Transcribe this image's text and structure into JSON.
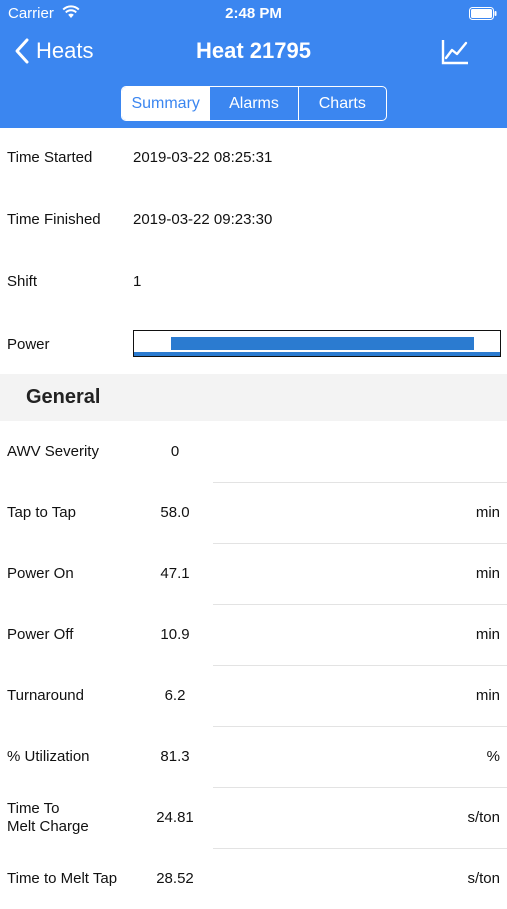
{
  "status": {
    "carrier": "Carrier",
    "time": "2:48 PM"
  },
  "nav": {
    "back_label": "Heats",
    "title": "Heat 21795",
    "chart_icon": "line-chart-icon"
  },
  "tabs": [
    {
      "label": "Summary",
      "active": true
    },
    {
      "label": "Alarms",
      "active": false
    },
    {
      "label": "Charts",
      "active": false
    }
  ],
  "summary": {
    "time_started": {
      "label": "Time Started",
      "value": "2019-03-22 08:25:31"
    },
    "time_finished": {
      "label": "Time Finished",
      "value": "2019-03-22 09:23:30"
    },
    "shift": {
      "label": "Shift",
      "value": "1"
    },
    "power": {
      "label": "Power",
      "fill_start_fraction": 0.1,
      "fill_end_fraction": 0.93
    }
  },
  "general": {
    "title": "General",
    "rows": [
      {
        "label": "AWV Severity",
        "value": "0",
        "unit": ""
      },
      {
        "label": "Tap to Tap",
        "value": "58.0",
        "unit": "min"
      },
      {
        "label": "Power On",
        "value": "47.1",
        "unit": "min"
      },
      {
        "label": "Power Off",
        "value": "10.9",
        "unit": "min"
      },
      {
        "label": "Turnaround",
        "value": "6.2",
        "unit": "min"
      },
      {
        "label": "% Utilization",
        "value": "81.3",
        "unit": "%"
      },
      {
        "label": "Time To\nMelt Charge",
        "value": "24.81",
        "unit": "s/ton"
      },
      {
        "label": "Time to Melt Tap",
        "value": "28.52",
        "unit": "s/ton"
      }
    ]
  },
  "colors": {
    "accent": "#3b86f0",
    "power_fill": "#2b7bd0"
  }
}
